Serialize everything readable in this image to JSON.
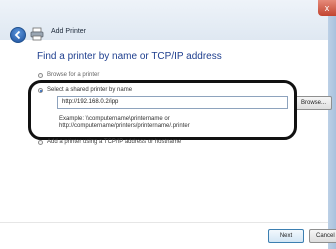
{
  "window": {
    "title": "Add Printer",
    "close_glyph": "x"
  },
  "main": {
    "heading": "Find a printer by name or TCP/IP address",
    "options": [
      {
        "label": "Browse for a printer",
        "selected": false
      },
      {
        "label": "Select a shared printer by name",
        "selected": true
      },
      {
        "label": "Add a printer using a TCP/IP address or hostname",
        "selected": false
      }
    ],
    "printer_name_value": "http://192.168.0.2/ipp",
    "browse_label": "Browse...",
    "example_line1": "Example: \\\\computername\\printername or",
    "example_line2": "http://computername/printers/printername/.printer"
  },
  "footer": {
    "next_label": "Next",
    "cancel_label": "Cancel"
  },
  "icons": {
    "back": "back-arrow-icon",
    "printer": "printer-icon"
  }
}
